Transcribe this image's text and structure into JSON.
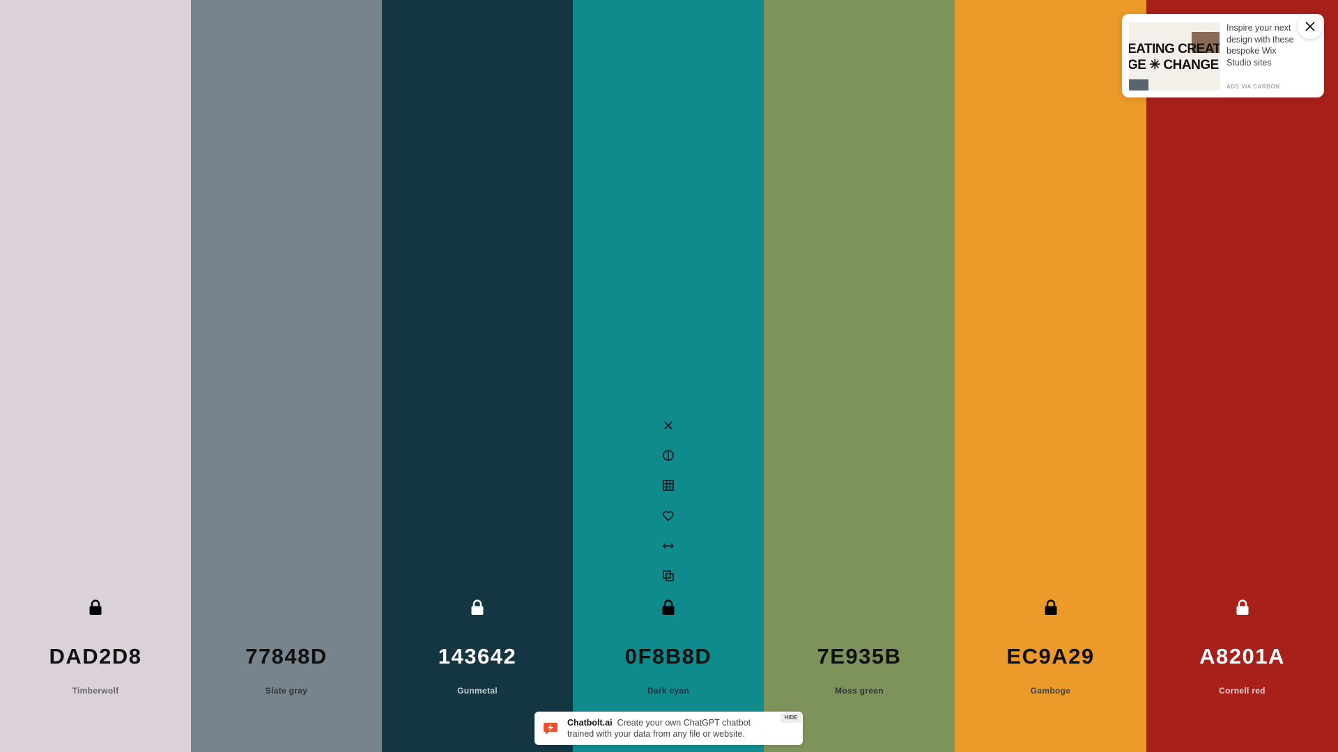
{
  "palette": [
    {
      "hex": "DAD2D8",
      "name": "Timberwolf",
      "color": "#DAD2D8",
      "text_color": "#111111",
      "sub_color": "#666666",
      "lock_color": "#000000",
      "locked": true
    },
    {
      "hex": "77848D",
      "name": "Slate gray",
      "color": "#77848D",
      "text_color": "#111111",
      "sub_color": "#333333",
      "lock_color": null,
      "locked": false
    },
    {
      "hex": "143642",
      "name": "Gunmetal",
      "color": "#143642",
      "text_color": "#FFFFFF",
      "sub_color": "#C8D0D4",
      "lock_color": "#FFFFFF",
      "locked": true
    },
    {
      "hex": "0F8B8D",
      "name": "Dark cyan",
      "color": "#0F8B8D",
      "text_color": "#111111",
      "sub_color": "#234",
      "lock_color": "#000000",
      "locked": true
    },
    {
      "hex": "7E935B",
      "name": "Moss green",
      "color": "#7E935B",
      "text_color": "#111111",
      "sub_color": "#333333",
      "lock_color": null,
      "locked": false
    },
    {
      "hex": "EC9A29",
      "name": "Gamboge",
      "color": "#EC9A29",
      "text_color": "#111111",
      "sub_color": "#444444",
      "lock_color": "#000000",
      "locked": true
    },
    {
      "hex": "A8201A",
      "name": "Cornell red",
      "color": "#A8201A",
      "text_color": "#FFFFFF",
      "sub_color": "#F0D0D0",
      "lock_color": "#FFFFFF",
      "locked": true
    }
  ],
  "tools": [
    "close-icon",
    "contrast-icon",
    "grid-icon",
    "heart-icon",
    "resize-arrows-icon",
    "copy-icon"
  ],
  "ad": {
    "image_line1": "EATING CREAT",
    "image_line2": "GE ✳ CHANGE",
    "text": "Inspire your next design with these bespoke Wix Studio sites",
    "via": "ADS VIA CARBON"
  },
  "banner": {
    "brand": "Chatbolt.ai",
    "text": "Create your own ChatGPT chatbot trained with your data from any file or website.",
    "hide_label": "HIDE",
    "logo_color": "#E8522A"
  }
}
